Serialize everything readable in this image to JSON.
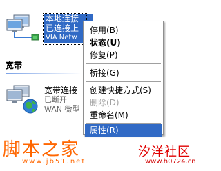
{
  "connection1": {
    "name": "本地连接",
    "status": "已连接上",
    "device": "VIA Netw"
  },
  "broadband_section": {
    "title": "宽带"
  },
  "connection2": {
    "name": "宽带连接",
    "status": "已断开",
    "device": "WAN 微型"
  },
  "menu": {
    "items": [
      {
        "label": "停用(B)",
        "bold": false,
        "disabled": false,
        "highlighted": false
      },
      {
        "label": "状态(U)",
        "bold": true,
        "disabled": false,
        "highlighted": false
      },
      {
        "label": "修复(P)",
        "bold": false,
        "disabled": false,
        "highlighted": false
      },
      {
        "label": "桥接(G)",
        "bold": false,
        "disabled": false,
        "highlighted": false
      },
      {
        "label": "创建快捷方式(S)",
        "bold": false,
        "disabled": false,
        "highlighted": false
      },
      {
        "label": "删除(D)",
        "bold": false,
        "disabled": true,
        "highlighted": false
      },
      {
        "label": "重命名(M)",
        "bold": false,
        "disabled": false,
        "highlighted": false
      },
      {
        "label": "属性(R)",
        "bold": false,
        "disabled": false,
        "highlighted": true
      }
    ]
  },
  "watermarks": {
    "left_title": "脚本之家",
    "left_url": "www.jb51.net",
    "right_title": "汐洋社区",
    "right_url": "www.h0724.cn"
  },
  "colors": {
    "selection": "#316ac5",
    "menu_border": "#8f8f8f",
    "disabled_text": "#a0a0a0",
    "watermark_orange": "#ff6600",
    "watermark_red": "#e00000"
  },
  "icons": {
    "connection1": "network-connection-icon",
    "connection2": "broadband-connection-icon"
  }
}
